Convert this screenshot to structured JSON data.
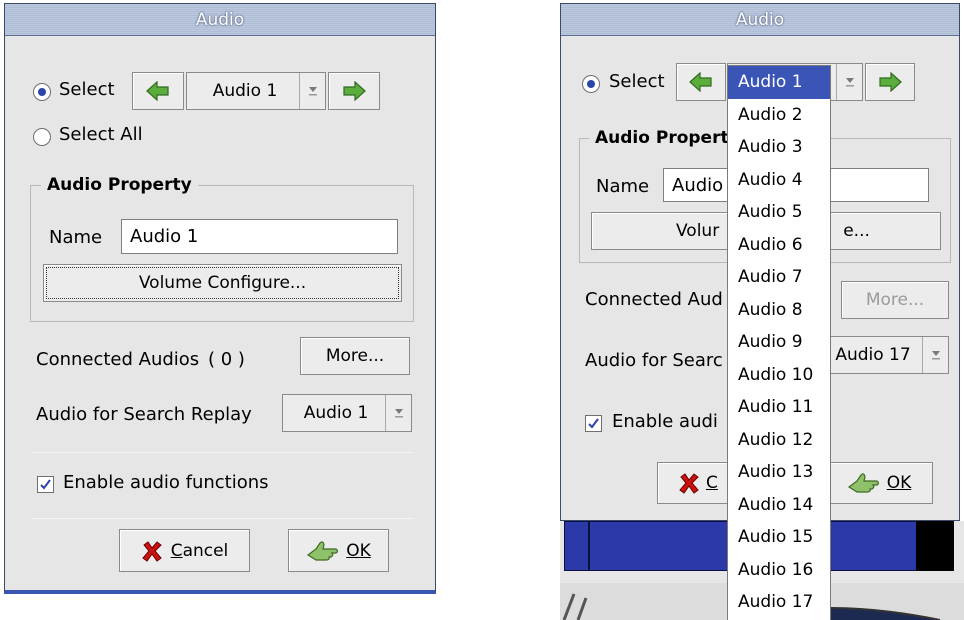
{
  "left_dialog": {
    "title": "Audio",
    "select_label": "Select",
    "select_all_label": "Select All",
    "audio_combo_value": "Audio 1",
    "group_title": "Audio Property",
    "name_label": "Name",
    "name_value": "Audio 1",
    "volume_button": "Volume Configure...",
    "connected_label": "Connected Audios",
    "connected_count": "( 0 )",
    "more_button": "More...",
    "search_replay_label": "Audio for Search Replay",
    "search_replay_value": "Audio 1",
    "enable_label": "Enable audio functions",
    "cancel_button": "Cancel",
    "ok_button": "OK"
  },
  "right_dialog": {
    "title": "Audio",
    "select_label": "Select",
    "group_title_partial": "Audio Propert",
    "name_label": "Name",
    "name_value_partial": "Audio",
    "volume_left_partial": "Volur",
    "volume_right_partial": "e...",
    "connected_partial": "Connected Aud",
    "more_button": "More...",
    "search_replay_partial": "Audio for Searc",
    "search_replay_value": "Audio 17",
    "enable_partial": "Enable audi",
    "cancel_partial": "C",
    "ok_button": "OK"
  },
  "dropdown": {
    "selected_index": 0,
    "items": [
      "Audio 1",
      "Audio 2",
      "Audio 3",
      "Audio 4",
      "Audio 5",
      "Audio 6",
      "Audio 7",
      "Audio 8",
      "Audio 9",
      "Audio 10",
      "Audio 11",
      "Audio 12",
      "Audio 13",
      "Audio 14",
      "Audio 15",
      "Audio 16",
      "Audio 17"
    ]
  },
  "icons": {
    "prev": "left-arrow-icon",
    "next": "right-arrow-icon",
    "cancel": "red-x-icon",
    "ok": "green-hand-icon",
    "check": "checkmark-icon"
  },
  "colors": {
    "title_text": "#ffffff",
    "selection": "#3b55b7",
    "arrow_green": "#5cae3c",
    "cancel_red": "#cc1111"
  }
}
